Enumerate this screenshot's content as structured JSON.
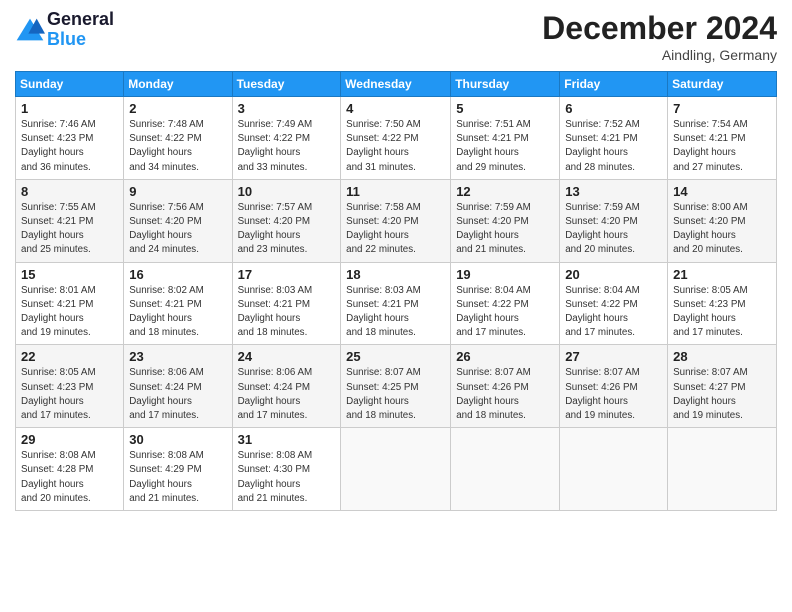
{
  "header": {
    "logo_line1": "General",
    "logo_line2": "Blue",
    "month": "December 2024",
    "location": "Aindling, Germany"
  },
  "days_of_week": [
    "Sunday",
    "Monday",
    "Tuesday",
    "Wednesday",
    "Thursday",
    "Friday",
    "Saturday"
  ],
  "weeks": [
    [
      {
        "day": "1",
        "sunrise": "7:46 AM",
        "sunset": "4:23 PM",
        "daylight": "8 hours and 36 minutes."
      },
      {
        "day": "2",
        "sunrise": "7:48 AM",
        "sunset": "4:22 PM",
        "daylight": "8 hours and 34 minutes."
      },
      {
        "day": "3",
        "sunrise": "7:49 AM",
        "sunset": "4:22 PM",
        "daylight": "8 hours and 33 minutes."
      },
      {
        "day": "4",
        "sunrise": "7:50 AM",
        "sunset": "4:22 PM",
        "daylight": "8 hours and 31 minutes."
      },
      {
        "day": "5",
        "sunrise": "7:51 AM",
        "sunset": "4:21 PM",
        "daylight": "8 hours and 29 minutes."
      },
      {
        "day": "6",
        "sunrise": "7:52 AM",
        "sunset": "4:21 PM",
        "daylight": "8 hours and 28 minutes."
      },
      {
        "day": "7",
        "sunrise": "7:54 AM",
        "sunset": "4:21 PM",
        "daylight": "8 hours and 27 minutes."
      }
    ],
    [
      {
        "day": "8",
        "sunrise": "7:55 AM",
        "sunset": "4:21 PM",
        "daylight": "8 hours and 25 minutes."
      },
      {
        "day": "9",
        "sunrise": "7:56 AM",
        "sunset": "4:20 PM",
        "daylight": "8 hours and 24 minutes."
      },
      {
        "day": "10",
        "sunrise": "7:57 AM",
        "sunset": "4:20 PM",
        "daylight": "8 hours and 23 minutes."
      },
      {
        "day": "11",
        "sunrise": "7:58 AM",
        "sunset": "4:20 PM",
        "daylight": "8 hours and 22 minutes."
      },
      {
        "day": "12",
        "sunrise": "7:59 AM",
        "sunset": "4:20 PM",
        "daylight": "8 hours and 21 minutes."
      },
      {
        "day": "13",
        "sunrise": "7:59 AM",
        "sunset": "4:20 PM",
        "daylight": "8 hours and 20 minutes."
      },
      {
        "day": "14",
        "sunrise": "8:00 AM",
        "sunset": "4:20 PM",
        "daylight": "8 hours and 20 minutes."
      }
    ],
    [
      {
        "day": "15",
        "sunrise": "8:01 AM",
        "sunset": "4:21 PM",
        "daylight": "8 hours and 19 minutes."
      },
      {
        "day": "16",
        "sunrise": "8:02 AM",
        "sunset": "4:21 PM",
        "daylight": "8 hours and 18 minutes."
      },
      {
        "day": "17",
        "sunrise": "8:03 AM",
        "sunset": "4:21 PM",
        "daylight": "8 hours and 18 minutes."
      },
      {
        "day": "18",
        "sunrise": "8:03 AM",
        "sunset": "4:21 PM",
        "daylight": "8 hours and 18 minutes."
      },
      {
        "day": "19",
        "sunrise": "8:04 AM",
        "sunset": "4:22 PM",
        "daylight": "8 hours and 17 minutes."
      },
      {
        "day": "20",
        "sunrise": "8:04 AM",
        "sunset": "4:22 PM",
        "daylight": "8 hours and 17 minutes."
      },
      {
        "day": "21",
        "sunrise": "8:05 AM",
        "sunset": "4:23 PM",
        "daylight": "8 hours and 17 minutes."
      }
    ],
    [
      {
        "day": "22",
        "sunrise": "8:05 AM",
        "sunset": "4:23 PM",
        "daylight": "8 hours and 17 minutes."
      },
      {
        "day": "23",
        "sunrise": "8:06 AM",
        "sunset": "4:24 PM",
        "daylight": "8 hours and 17 minutes."
      },
      {
        "day": "24",
        "sunrise": "8:06 AM",
        "sunset": "4:24 PM",
        "daylight": "8 hours and 17 minutes."
      },
      {
        "day": "25",
        "sunrise": "8:07 AM",
        "sunset": "4:25 PM",
        "daylight": "8 hours and 18 minutes."
      },
      {
        "day": "26",
        "sunrise": "8:07 AM",
        "sunset": "4:26 PM",
        "daylight": "8 hours and 18 minutes."
      },
      {
        "day": "27",
        "sunrise": "8:07 AM",
        "sunset": "4:26 PM",
        "daylight": "8 hours and 19 minutes."
      },
      {
        "day": "28",
        "sunrise": "8:07 AM",
        "sunset": "4:27 PM",
        "daylight": "8 hours and 19 minutes."
      }
    ],
    [
      {
        "day": "29",
        "sunrise": "8:08 AM",
        "sunset": "4:28 PM",
        "daylight": "8 hours and 20 minutes."
      },
      {
        "day": "30",
        "sunrise": "8:08 AM",
        "sunset": "4:29 PM",
        "daylight": "8 hours and 21 minutes."
      },
      {
        "day": "31",
        "sunrise": "8:08 AM",
        "sunset": "4:30 PM",
        "daylight": "8 hours and 21 minutes."
      },
      null,
      null,
      null,
      null
    ]
  ]
}
